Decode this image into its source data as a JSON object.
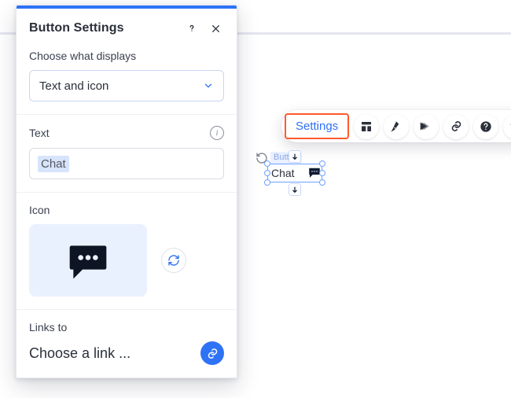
{
  "panel": {
    "title": "Button Settings",
    "display": {
      "label": "Choose what displays",
      "value": "Text and icon"
    },
    "text": {
      "label": "Text",
      "value": "Chat"
    },
    "icon": {
      "label": "Icon",
      "name": "chat-bubble-icon"
    },
    "links": {
      "label": "Links to",
      "value": "Choose a link ..."
    }
  },
  "toolbar": {
    "settings_label": "Settings"
  },
  "canvas": {
    "element_tag": "Button",
    "element_text": "Chat"
  },
  "colors": {
    "accent": "#2e72f6",
    "highlight_border": "#ff5a2c"
  }
}
